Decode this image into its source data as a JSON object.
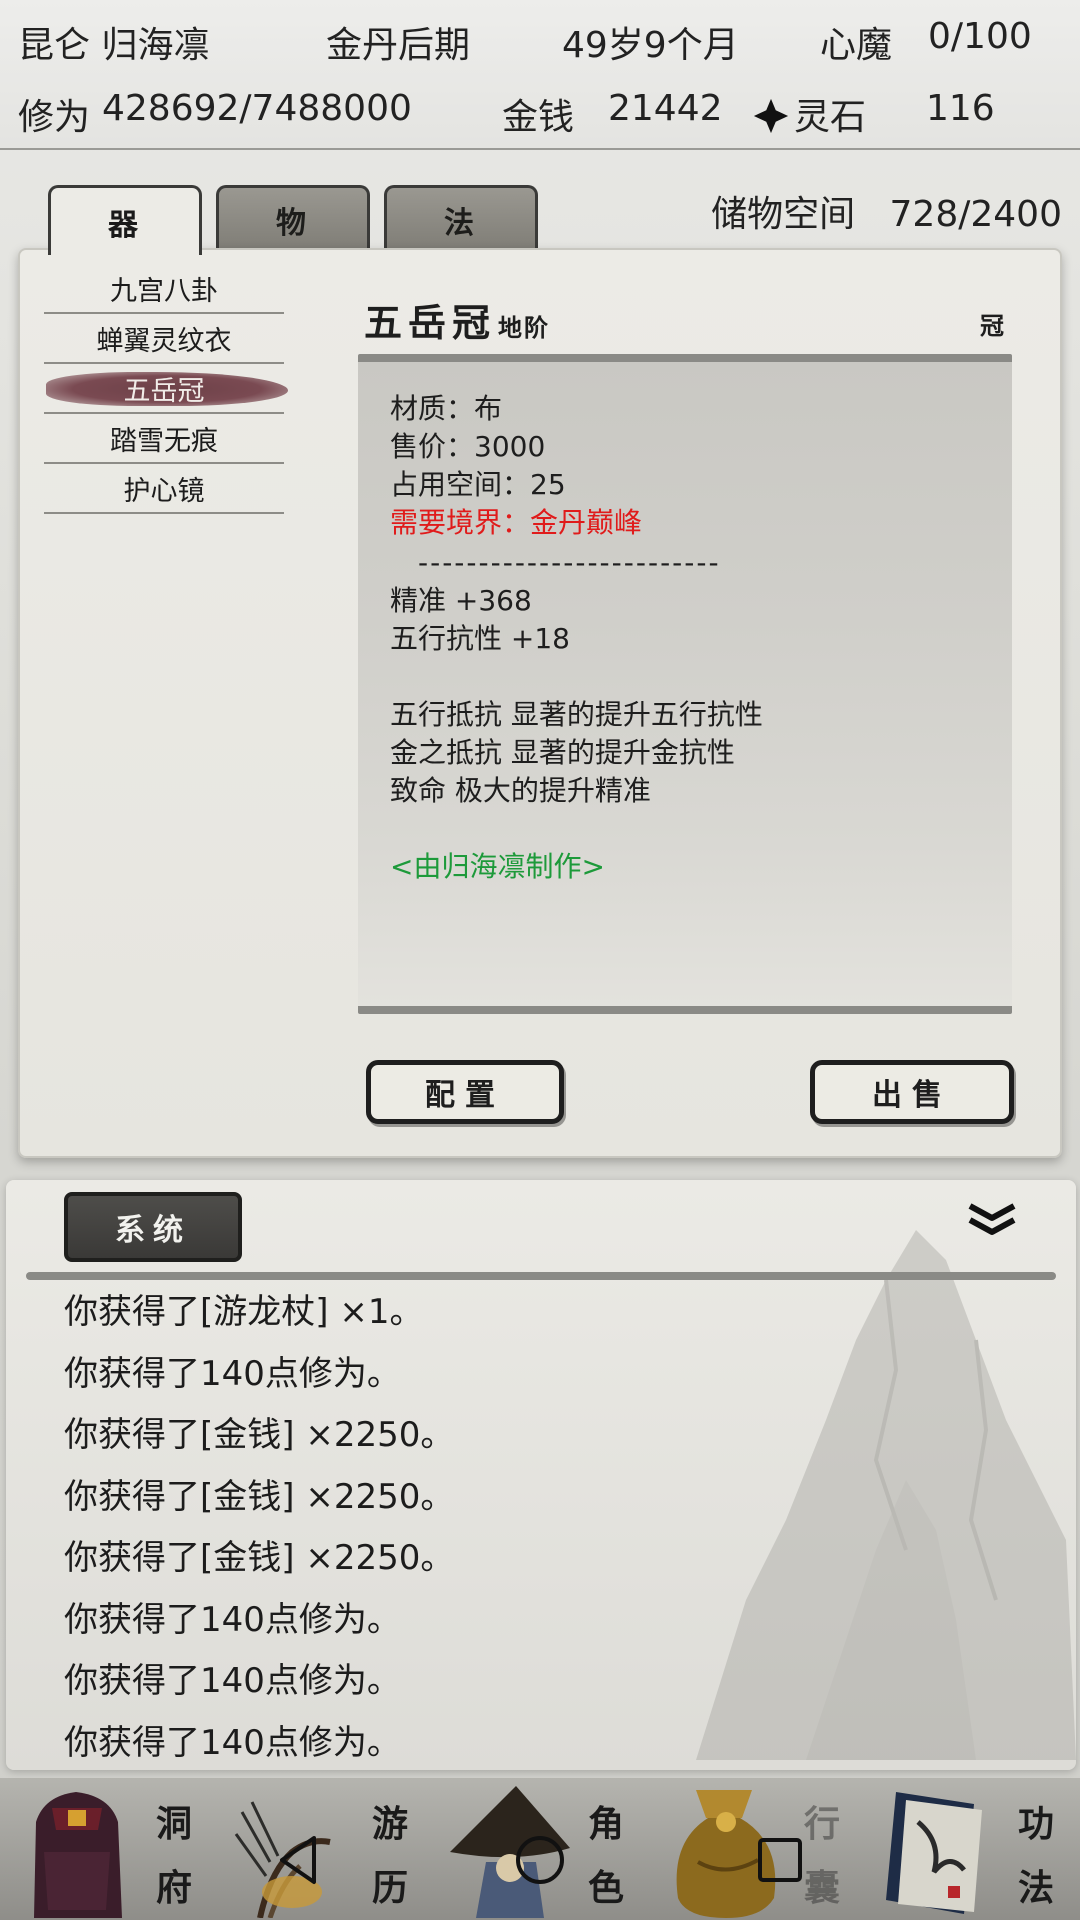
{
  "status": {
    "sect_name": "昆仑 归海凛",
    "realm": "金丹后期",
    "age": "49岁9个月",
    "demon_label": "心魔",
    "demon_value": "0/100",
    "cultivation_label": "修为",
    "cultivation_value": "428692/7488000",
    "money_label": "金钱",
    "money_value": "21442",
    "spirit_stone_label": "灵石",
    "spirit_stone_value": "116"
  },
  "tabs": [
    {
      "label": "器",
      "active": true
    },
    {
      "label": "物",
      "active": false
    },
    {
      "label": "法",
      "active": false
    }
  ],
  "storage": {
    "label": "储物空间",
    "value": "728/2400"
  },
  "items": [
    {
      "name": "九宫八卦"
    },
    {
      "name": "蝉翼灵纹衣"
    },
    {
      "name": "五岳冠",
      "selected": true
    },
    {
      "name": "踏雪无痕"
    },
    {
      "name": "护心镜"
    }
  ],
  "detail": {
    "name": "五岳冠",
    "grade": "地阶",
    "slot": "冠",
    "material": "材质：布",
    "price": "售价：3000",
    "space": "占用空间：25",
    "requirement": "需要境界：金丹巅峰",
    "separator": "-------------------------",
    "stats": [
      "精准 +368",
      "五行抗性 +18"
    ],
    "effects": [
      "五行抵抗 显著的提升五行抗性",
      "金之抵抗 显著的提升金抗性",
      "致命 极大的提升精准"
    ],
    "maker": "<由归海凛制作>"
  },
  "buttons": {
    "equip": "配置",
    "sell": "出售"
  },
  "log": {
    "tab_label": "系统",
    "lines": [
      "你获得了[游龙杖] ×1。",
      "你获得了140点修为。",
      "你获得了[金钱] ×2250。",
      "你获得了[金钱] ×2250。",
      "你获得了[金钱] ×2250。",
      "你获得了140点修为。",
      "你获得了140点修为。",
      "你获得了140点修为。"
    ]
  },
  "nav": [
    {
      "label": "洞府",
      "icon": "cave-icon"
    },
    {
      "label": "游历",
      "icon": "travel-icon"
    },
    {
      "label": "角色",
      "icon": "character-icon"
    },
    {
      "label": "行囊",
      "icon": "bag-icon"
    },
    {
      "label": "功法",
      "icon": "manual-icon"
    }
  ],
  "colors": {
    "requirement": "#e01b1b",
    "maker": "#1d9a3a",
    "selected_item": "#6d4148"
  }
}
